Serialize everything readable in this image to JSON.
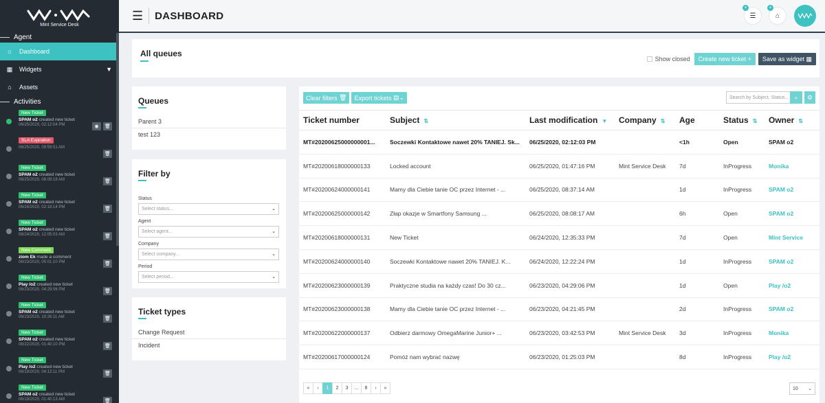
{
  "sidebar": {
    "logo_text": "Mint Service Desk",
    "section_agent": "Agent",
    "nav": [
      {
        "label": "Dashboard"
      },
      {
        "label": "Widgets"
      },
      {
        "label": "Assets"
      }
    ],
    "section_activities": "Activities",
    "activities": [
      {
        "badge": "New Ticket",
        "actor": "SPAM o2",
        "action": "created new ticket",
        "time": "06/25/2020, 02:12:04 PM"
      },
      {
        "badge": "SLA Expiration",
        "actor": "",
        "action": "",
        "time": "06/25/2020, 09:59:51 AM"
      },
      {
        "badge": "New Ticket",
        "actor": "SPAM o2",
        "action": "created new ticket",
        "time": "06/25/2020, 08:08:18 AM"
      },
      {
        "badge": "New Ticket",
        "actor": "SPAM o2",
        "action": "created new ticket",
        "time": "06/24/2020, 02:18:14 PM"
      },
      {
        "badge": "New Ticket",
        "actor": "SPAM o2",
        "action": "created new ticket",
        "time": "06/24/2020, 12:05:03 AM"
      },
      {
        "badge": "New Comment",
        "actor": "ziom Ek",
        "action": "made a comment",
        "time": "06/23/2020, 05:01:10 PM"
      },
      {
        "badge": "New Ticket",
        "actor": "Play /o2",
        "action": "created new ticket",
        "time": "06/23/2020, 04:29:06 PM"
      },
      {
        "badge": "New Ticket",
        "actor": "SPAM o2",
        "action": "created new ticket",
        "time": "06/23/2020, 10:26:11 AM"
      },
      {
        "badge": "New Ticket",
        "actor": "SPAM o2",
        "action": "created new ticket",
        "time": "06/22/2020, 01:40:10 PM"
      },
      {
        "badge": "New Ticket",
        "actor": "Play /o2",
        "action": "created new ticket",
        "time": "06/19/2020, 04:13:11 PM"
      },
      {
        "badge": "New Ticket",
        "actor": "SPAM o2",
        "action": "created new ticket",
        "time": "06/19/2020, 01:40:13 AM"
      }
    ]
  },
  "topbar": {
    "title": "DASHBOARD"
  },
  "queues_bar": {
    "title": "All queues",
    "show_closed": "Show closed",
    "create_btn": "Create new ticket",
    "save_btn": "Save as widget"
  },
  "queues": {
    "title": "Queues",
    "items": [
      "Parent 3",
      "test 123"
    ]
  },
  "filter": {
    "title": "Filter by",
    "fields": [
      {
        "label": "Status",
        "placeholder": "Select status..."
      },
      {
        "label": "Agent",
        "placeholder": "Select agent..."
      },
      {
        "label": "Company",
        "placeholder": "Select company..."
      },
      {
        "label": "Period",
        "placeholder": "Select period..."
      }
    ]
  },
  "ticket_types": {
    "title": "Ticket types",
    "items": [
      "Change Request",
      "Incident"
    ]
  },
  "table": {
    "clear_filters": "Clear filters",
    "export_tickets": "Export tickets",
    "search_placeholder": "Search by Subject, Status...",
    "headers": [
      "Ticket number",
      "Subject",
      "Last modification",
      "Company",
      "Age",
      "Status",
      "Owner"
    ],
    "rows": [
      [
        "MT#20200625000000001...",
        "Soczewki Kontaktowe nawet 20% TANIEJ. Sk...",
        "06/25/2020, 02:12:03 PM",
        "",
        "<1h",
        "Open",
        "SPAM o2"
      ],
      [
        "MT#20200618000000133",
        "Locked account",
        "06/25/2020, 01:47:16 PM",
        "Mint Service Desk",
        "7d",
        "InProgress",
        "Monika"
      ],
      [
        "MT#20200624000000141",
        "Mamy dla Ciebie tanie OC przez Internet - ...",
        "06/25/2020, 08:37:14 AM",
        "",
        "1d",
        "InProgress",
        "SPAM o2"
      ],
      [
        "MT#20200625000000142",
        "Złap okazje w        Smartfony Samsung ...",
        "06/25/2020, 08:08:17 AM",
        "",
        "6h",
        "Open",
        "SPAM o2"
      ],
      [
        "MT#20200618000000131",
        "New Ticket",
        "06/24/2020, 12:35:33 PM",
        "",
        "7d",
        "Open",
        "Mint Service"
      ],
      [
        "MT#20200624000000140",
        "Soczewki Kontaktowe nawet 20% TANIEJ. K...",
        "06/24/2020, 12:22:24 PM",
        "",
        "1d",
        "InProgress",
        "SPAM o2"
      ],
      [
        "MT#20200623000000139",
        "Praktyczne studia na każdy czas! Do 30 cz...",
        "06/23/2020, 04:29:06 PM",
        "",
        "1d",
        "Open",
        "Play /o2"
      ],
      [
        "MT#20200623000000138",
        "Mamy dla Ciebie tanie OC przez Internet - ...",
        "06/23/2020, 04:21:45 PM",
        "",
        "2d",
        "InProgress",
        "SPAM o2"
      ],
      [
        "MT#20200622000000137",
        "Odbierz darmowy OmegaMarine Junior+ ...",
        "06/23/2020, 03:42:53 PM",
        "Mint Service Desk",
        "3d",
        "InProgress",
        "Monika"
      ],
      [
        "MT#20200617000000124",
        "Pomóż nam wybrać nazwę",
        "06/23/2020, 01:25:03 PM",
        "",
        "8d",
        "InProgress",
        "Play /o2"
      ]
    ]
  },
  "pager": {
    "items": [
      "«",
      "‹",
      "1",
      "2",
      "3",
      "...",
      "8",
      "›",
      "»"
    ],
    "active": "1",
    "page_size": "10"
  },
  "colors": {
    "accent": "#3dc1c1",
    "sidebar": "#242b33",
    "dark_button": "#3f5566"
  }
}
